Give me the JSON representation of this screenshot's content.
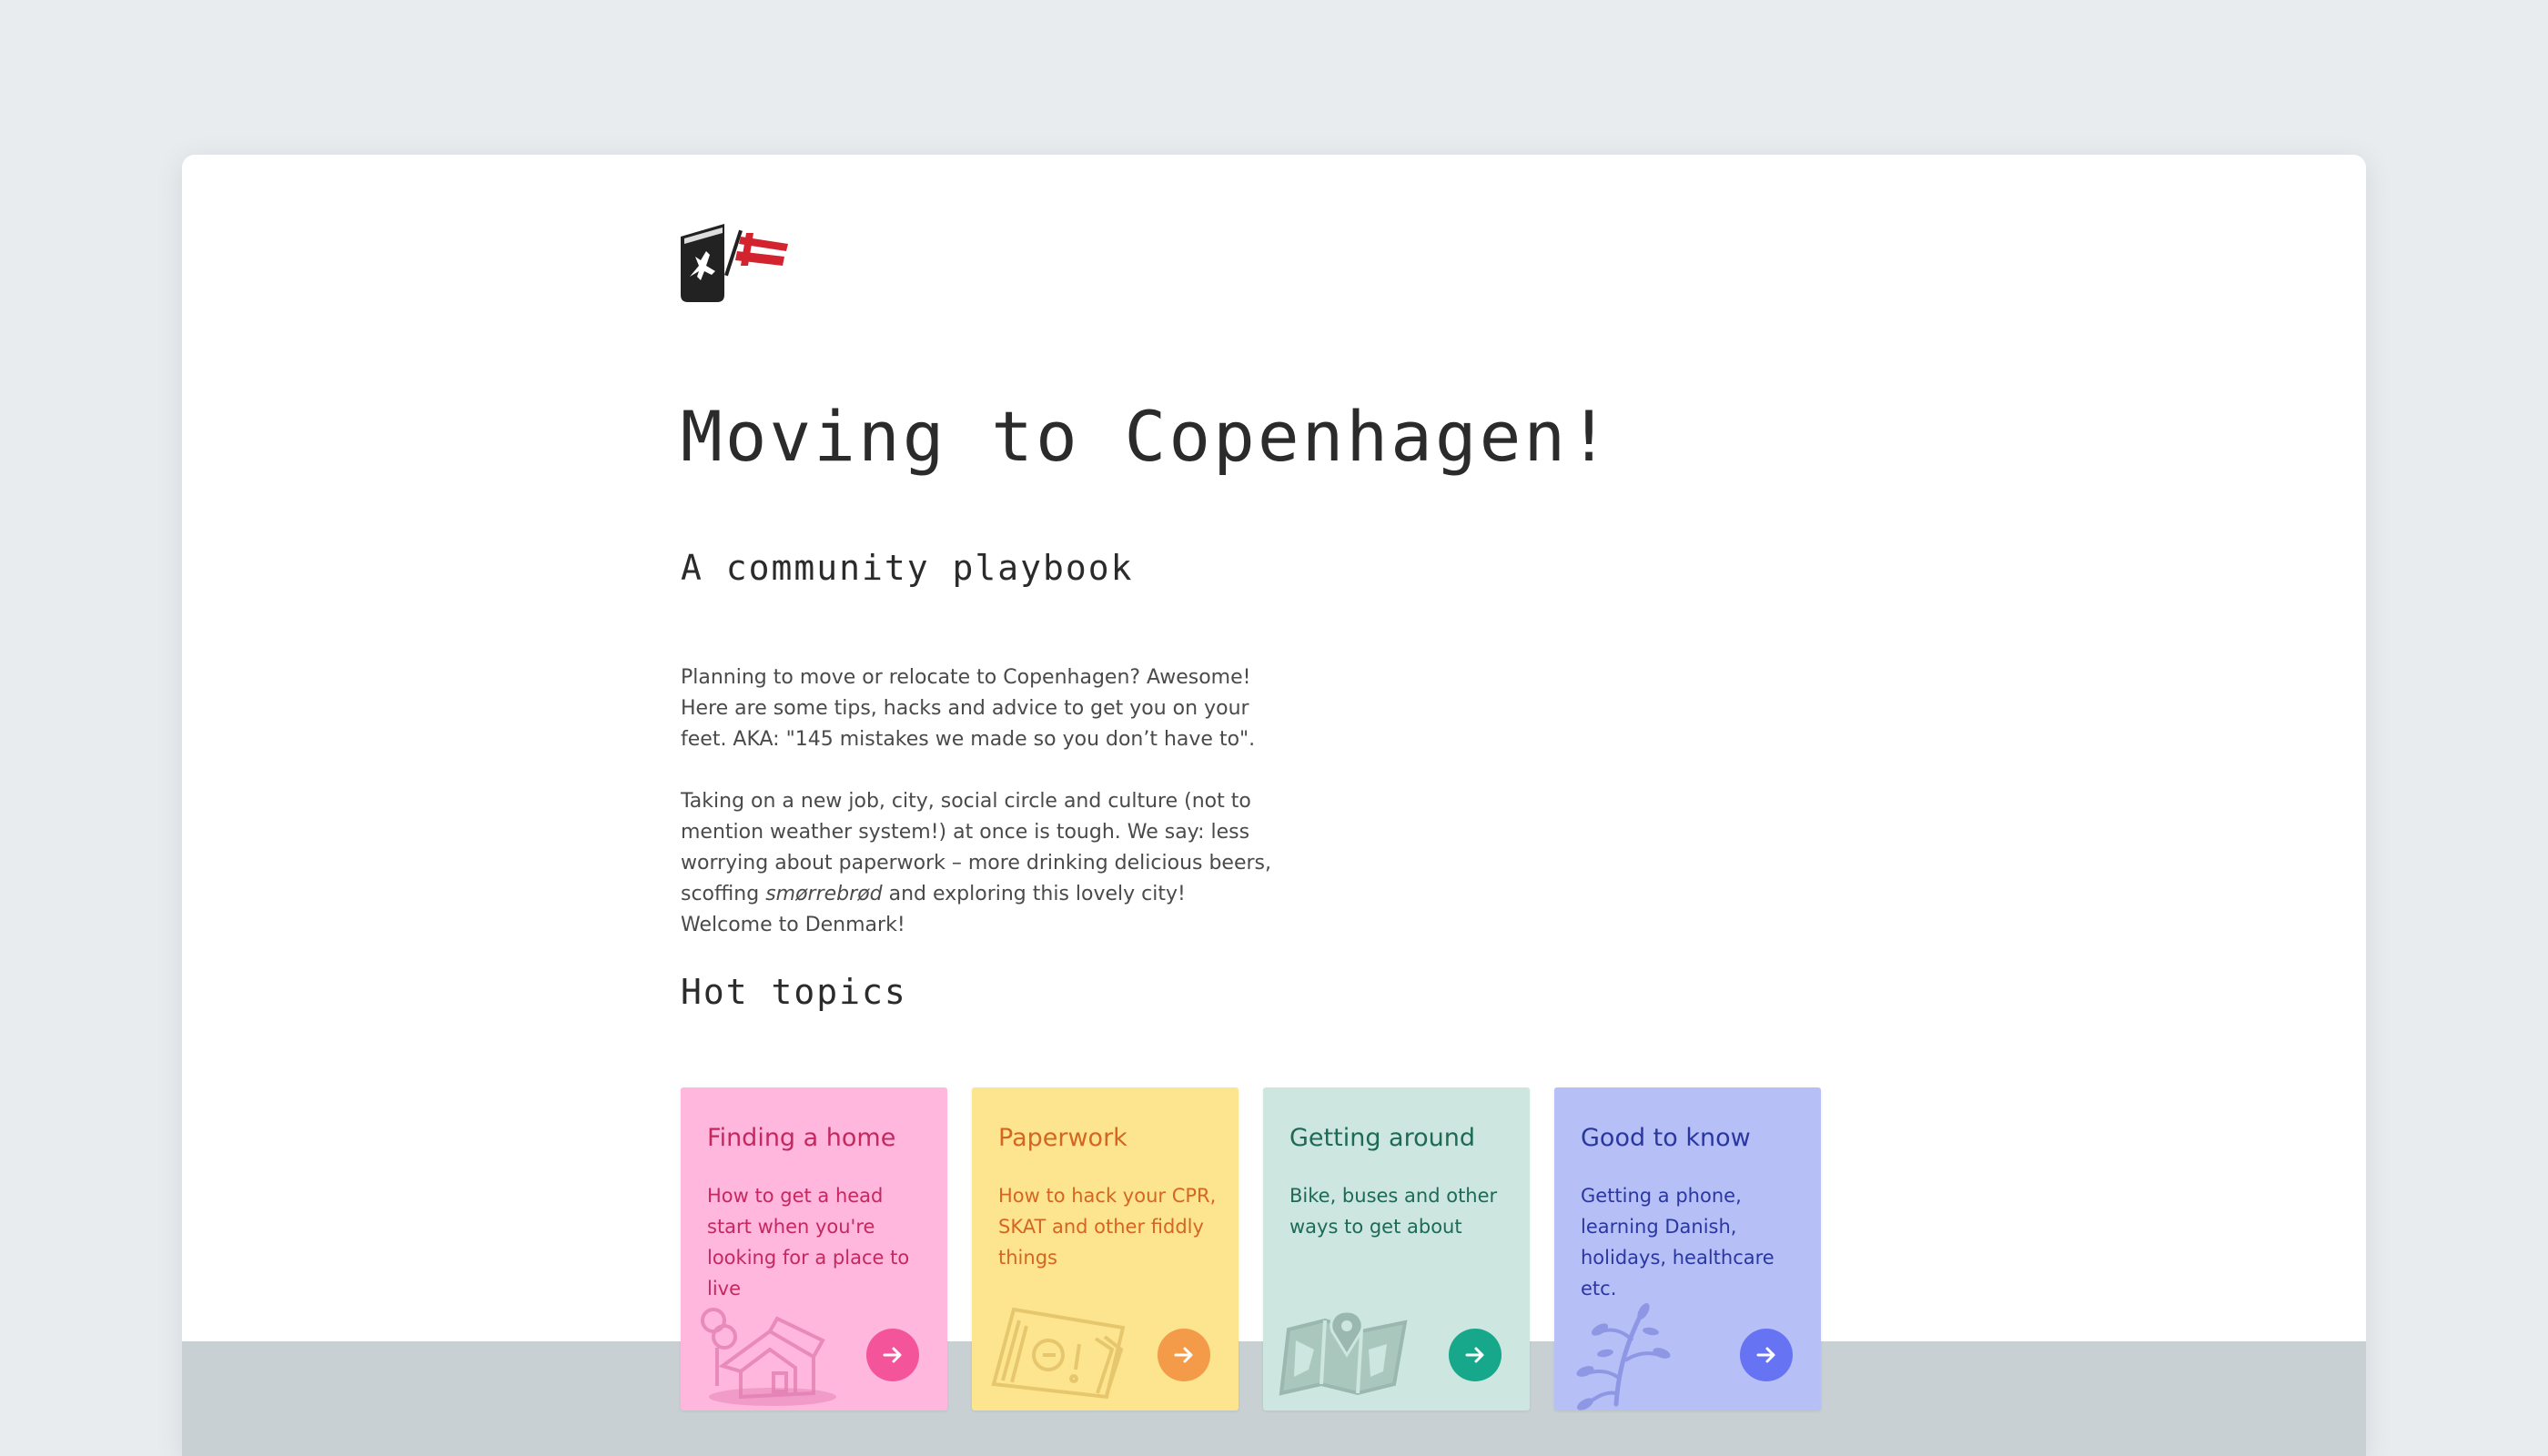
{
  "page": {
    "title": "Moving to Copenhagen!",
    "subtitle": "A community playbook",
    "intro_p1": "Planning to move or relocate to Copenhagen? Awesome! Here are some tips, hacks and advice to get you on your feet. AKA: \"145 mistakes we made so you don’t have to\".",
    "intro_p2_before": "Taking on a new job, city, social circle and culture (not to mention weather system!) at once is tough. We say: less worrying about paperwork – more drinking delicious beers, scoffing ",
    "intro_p2_em": "smørrebrød",
    "intro_p2_after": " and exploring this lovely city! Welcome to Denmark!",
    "hot_topics_heading": "Hot topics"
  },
  "cards": [
    {
      "title": "Finding a home",
      "description": "How to get a head start when you're looking for a place to live",
      "icon": "house-icon",
      "bg": "#ffb7de",
      "text_color": "#c4285f",
      "arrow_color": "#f4559a"
    },
    {
      "title": "Paperwork",
      "description": "How to hack your CPR, SKAT and other fiddly things",
      "icon": "documents-icon",
      "bg": "#fde58f",
      "text_color": "#d56522",
      "arrow_color": "#f39b49"
    },
    {
      "title": "Getting around",
      "description": "Bike, buses and other ways to get about",
      "icon": "map-icon",
      "bg": "#cde6df",
      "text_color": "#1d6a55",
      "arrow_color": "#17a78b"
    },
    {
      "title": "Good to know",
      "description": "Getting a phone, learning Danish, holidays, healthcare etc.",
      "icon": "plant-icon",
      "bg": "#b7c0f6",
      "text_color": "#2a37a0",
      "arrow_color": "#6673f3"
    }
  ],
  "colors": {
    "background": "#e8ecef",
    "window": "#ffffff",
    "footer_band": "#c8d0d3",
    "heading_text": "#2b2b2b",
    "body_text": "#4a4a4a",
    "flag_red": "#d3232e"
  },
  "logo": {
    "icon": "passport-flag-logo"
  }
}
